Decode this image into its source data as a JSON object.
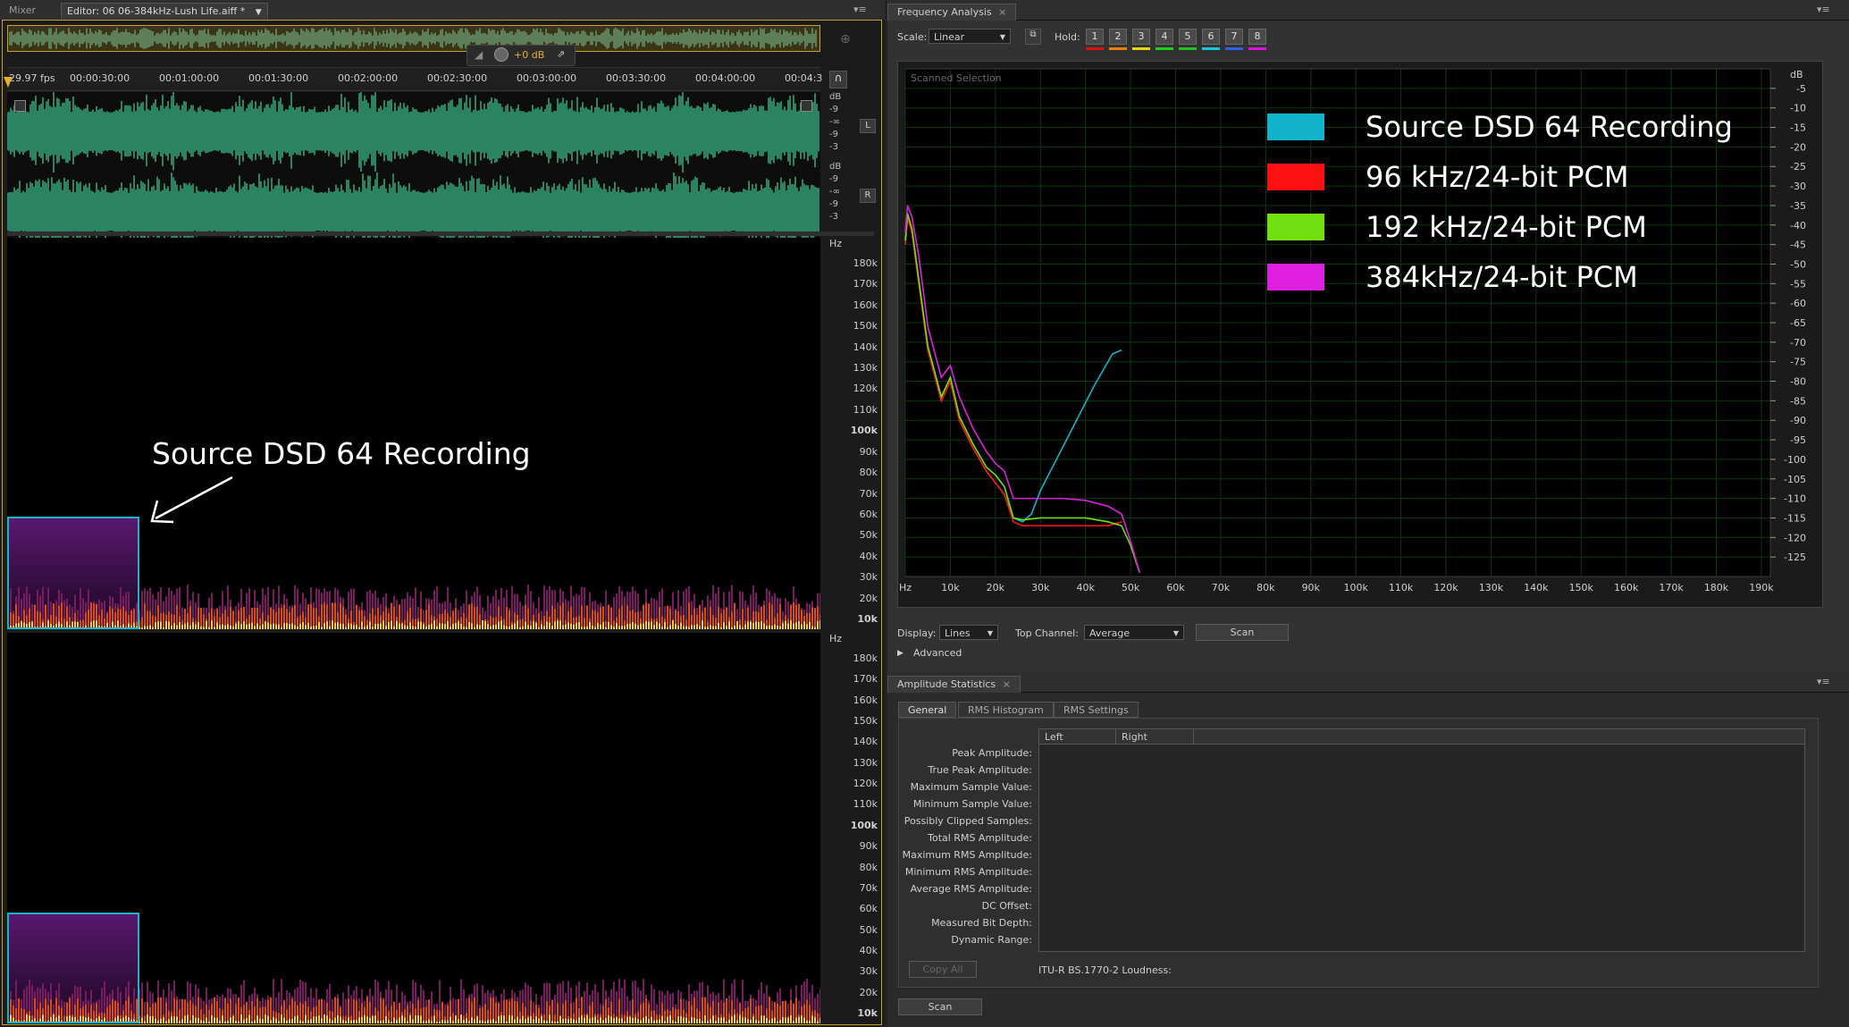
{
  "editor": {
    "tabs": [
      "Mixer",
      "Editor: 06 06-384kHz-Lush Life.aiff *"
    ],
    "volume_label": "+0 dB",
    "fps_label": "29.97 fps",
    "time_ticks": [
      "00:00:30:00",
      "00:01:00:00",
      "00:01:30:00",
      "00:02:00:00",
      "00:02:30:00",
      "00:03:00:00",
      "00:03:30:00",
      "00:04:00:00",
      "00:04:3"
    ],
    "db_unit": "dB",
    "db_ticks": [
      "-9",
      "-∞",
      "-9",
      "-3"
    ],
    "channel_left": "L",
    "channel_right": "R",
    "hz_unit": "Hz",
    "hz_ticks": [
      "180k",
      "170k",
      "160k",
      "150k",
      "140k",
      "130k",
      "120k",
      "110k",
      "100k",
      "90k",
      "80k",
      "70k",
      "60k",
      "50k",
      "40k",
      "30k",
      "20k",
      "10k"
    ],
    "annotation": "Source DSD 64 Recording"
  },
  "freq": {
    "title": "Frequency Analysis",
    "scale_label": "Scale:",
    "scale_value": "Linear",
    "hold_label": "Hold:",
    "holds": [
      {
        "n": "1",
        "color": "#e01010"
      },
      {
        "n": "2",
        "color": "#f08000"
      },
      {
        "n": "3",
        "color": "#e8d800"
      },
      {
        "n": "4",
        "color": "#20d020"
      },
      {
        "n": "5",
        "color": "#20c020"
      },
      {
        "n": "6",
        "color": "#10c8e0"
      },
      {
        "n": "7",
        "color": "#3060f0"
      },
      {
        "n": "8",
        "color": "#e010e0"
      }
    ],
    "display_label": "Display:",
    "display_value": "Lines",
    "top_channel_label": "Top Channel:",
    "top_channel_value": "Average",
    "scan_button": "Scan",
    "advanced_label": "Advanced",
    "chart_data": {
      "type": "line",
      "title": "Scanned Selection",
      "x_ticks": [
        "Hz",
        "10k",
        "20k",
        "30k",
        "40k",
        "50k",
        "60k",
        "70k",
        "80k",
        "90k",
        "100k",
        "110k",
        "120k",
        "130k",
        "140k",
        "150k",
        "160k",
        "170k",
        "180k",
        "190k"
      ],
      "y_unit": "dB",
      "y_ticks": [
        "-5",
        "-10",
        "-15",
        "-20",
        "-25",
        "-30",
        "-35",
        "-40",
        "-45",
        "-50",
        "-55",
        "-60",
        "-65",
        "-70",
        "-75",
        "-80",
        "-85",
        "-90",
        "-95",
        "-100",
        "-105",
        "-110",
        "-115",
        "-120",
        "-125"
      ],
      "xlim": [
        0,
        192000
      ],
      "ylim": [
        -130,
        0
      ],
      "grid": true,
      "legend_position": "top-right",
      "series": [
        {
          "name": "Source DSD 64 Recording",
          "color": "#12b4cc",
          "x": [
            0,
            500,
            1500,
            3000,
            5000,
            8000,
            10000,
            12000,
            15000,
            18000,
            20000,
            22000,
            24000,
            26000,
            28000,
            30000,
            34000,
            38000,
            42000,
            46000,
            48000
          ],
          "y": [
            -45,
            -38,
            -42,
            -55,
            -72,
            -85,
            -80,
            -90,
            -97,
            -103,
            -106,
            -109,
            -115,
            -116,
            -114,
            -108,
            -99,
            -90,
            -81,
            -73,
            -72
          ]
        },
        {
          "name": "96 kHz/24-bit PCM",
          "color": "#ff1010",
          "x": [
            0,
            500,
            1500,
            3000,
            5000,
            8000,
            10000,
            12000,
            15000,
            18000,
            20000,
            22000,
            24000,
            26000,
            30000,
            35000,
            40000,
            45000,
            48000
          ],
          "y": [
            -45,
            -38,
            -42,
            -55,
            -72,
            -85,
            -80,
            -90,
            -97,
            -103,
            -106,
            -109,
            -116,
            -117,
            -117,
            -117,
            -117,
            -117,
            -116
          ]
        },
        {
          "name": "192 kHz/24-bit PCM",
          "color": "#70e010",
          "x": [
            0,
            500,
            1500,
            3000,
            5000,
            8000,
            10000,
            12000,
            15000,
            18000,
            20000,
            22000,
            24000,
            26000,
            30000,
            35000,
            40000,
            45000,
            48000,
            50000,
            52000
          ],
          "y": [
            -44,
            -37,
            -41,
            -54,
            -71,
            -84,
            -79,
            -89,
            -96,
            -102,
            -104,
            -107,
            -115,
            -115.5,
            -115,
            -115,
            -115,
            -116,
            -117,
            -122,
            -129
          ]
        },
        {
          "name": "384kHz/24-bit PCM",
          "color": "#e020e0",
          "x": [
            0,
            500,
            1500,
            3000,
            5000,
            8000,
            10000,
            12000,
            15000,
            18000,
            20000,
            22000,
            24000,
            26000,
            30000,
            35000,
            40000,
            45000,
            48000,
            50000,
            52000
          ],
          "y": [
            -42,
            -35,
            -38,
            -48,
            -66,
            -79,
            -76,
            -84,
            -92,
            -98,
            -101,
            -103,
            -110,
            -110,
            -110,
            -110,
            -110.5,
            -112,
            -114,
            -121,
            -129
          ]
        }
      ]
    }
  },
  "amp": {
    "title": "Amplitude Statistics",
    "tabs": [
      "General",
      "RMS Histogram",
      "RMS Settings"
    ],
    "columns": [
      "Left",
      "Right"
    ],
    "rows": [
      "Peak Amplitude:",
      "True Peak Amplitude:",
      "Maximum Sample Value:",
      "Minimum Sample Value:",
      "Possibly Clipped Samples:",
      "Total RMS Amplitude:",
      "Maximum RMS Amplitude:",
      "Minimum RMS Amplitude:",
      "Average RMS Amplitude:",
      "DC Offset:",
      "Measured Bit Depth:",
      "Dynamic Range:"
    ],
    "copy_all": "Copy All",
    "loudness_label": "ITU-R BS.1770-2 Loudness:",
    "scan_button": "Scan"
  }
}
